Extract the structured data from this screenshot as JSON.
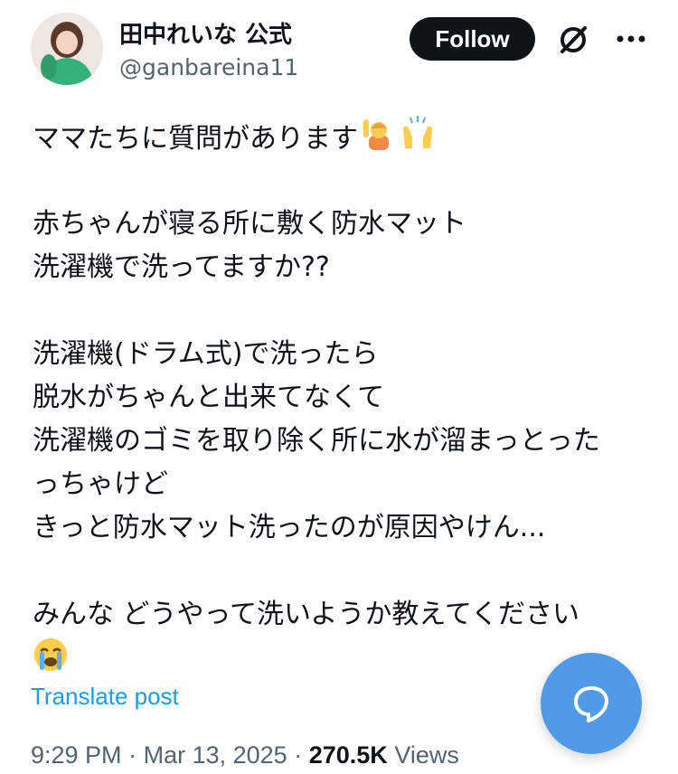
{
  "author": {
    "name": "田中れいな 公式",
    "handle": "@ganbareina11"
  },
  "actions": {
    "follow_label": "Follow"
  },
  "icons": {
    "avatar": "avatar-photo",
    "grok": "grok-icon",
    "more": "more-icon",
    "emoji_1": "person-raising-hand-emoji",
    "emoji_2": "raising-hands-emoji",
    "emoji_3": "loudly-crying-face-emoji",
    "fab": "message-bubble-icon"
  },
  "post": {
    "lines": [
      "ママたちに質問があります",
      "",
      "赤ちゃんが寝る所に敷く防水マット",
      "洗濯機で洗ってますか??",
      "",
      "洗濯機(ドラム式)で洗ったら",
      "脱水がちゃんと出来てなくて",
      "洗濯機のゴミを取り除く所に水が溜まっとった",
      "っちゃけど",
      "きっと防水マット洗ったのが原因やけん...",
      "",
      "みんな どうやって洗いようか教えてください"
    ]
  },
  "translate_label": "Translate post",
  "meta": {
    "time": "9:29 PM",
    "separator": "·",
    "date": "Mar 13, 2025",
    "views_count": "270.5K",
    "views_label": "Views"
  },
  "colors": {
    "link": "#1d9bf0",
    "fab": "#4f9be8",
    "text": "#0f1419",
    "secondary": "#536471"
  }
}
